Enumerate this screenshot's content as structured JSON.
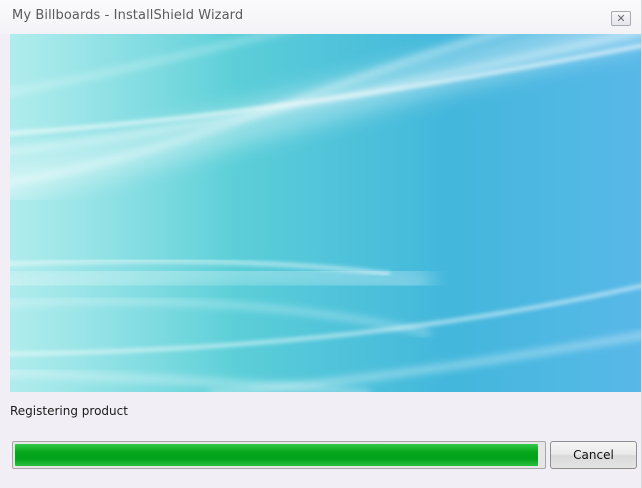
{
  "window": {
    "title": "My Billboards - InstallShield Wizard",
    "close_glyph": "✕"
  },
  "status": {
    "text": "Registering product"
  },
  "progress": {
    "percent": 99,
    "color": "#07a81c"
  },
  "buttons": {
    "cancel_label": "Cancel"
  },
  "banner": {
    "icon": "teal-light-streaks-image",
    "colors": [
      "#7fdde2",
      "#55c9d6",
      "#46b8db",
      "#4fb4e6"
    ]
  }
}
